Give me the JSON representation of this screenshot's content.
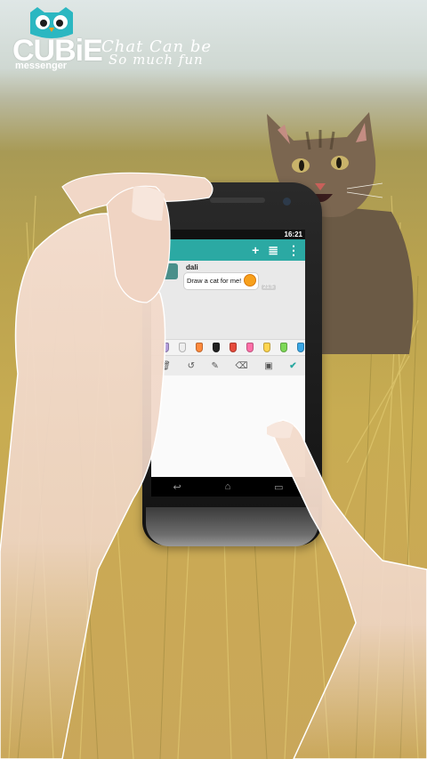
{
  "brand": {
    "name": "CUBiE",
    "sub": "messenger"
  },
  "tagline": {
    "line1": "Chat Can be",
    "line2": "So much fun"
  },
  "status_bar": {
    "time": "16:21"
  },
  "app_bar": {
    "add_label": "+",
    "compose_label": "≣",
    "menu_label": "⋮"
  },
  "message": {
    "sender": "dali",
    "text": "Draw a cat for me!",
    "time": "21:5"
  },
  "palette": {
    "colors": [
      "#b39ddb",
      "#eeeeee",
      "#ff8a3d",
      "#222222",
      "#e64b3c",
      "#ff6fa8",
      "#ffd54f",
      "#7ed957",
      "#3aa7e6"
    ]
  },
  "tools": {
    "trash": "🗑",
    "undo": "↺",
    "pen": "✎",
    "eraser": "⌫",
    "layers": "▣",
    "done": "✔"
  },
  "nav": {
    "back": "↩",
    "home": "⌂",
    "recents": "▭"
  }
}
